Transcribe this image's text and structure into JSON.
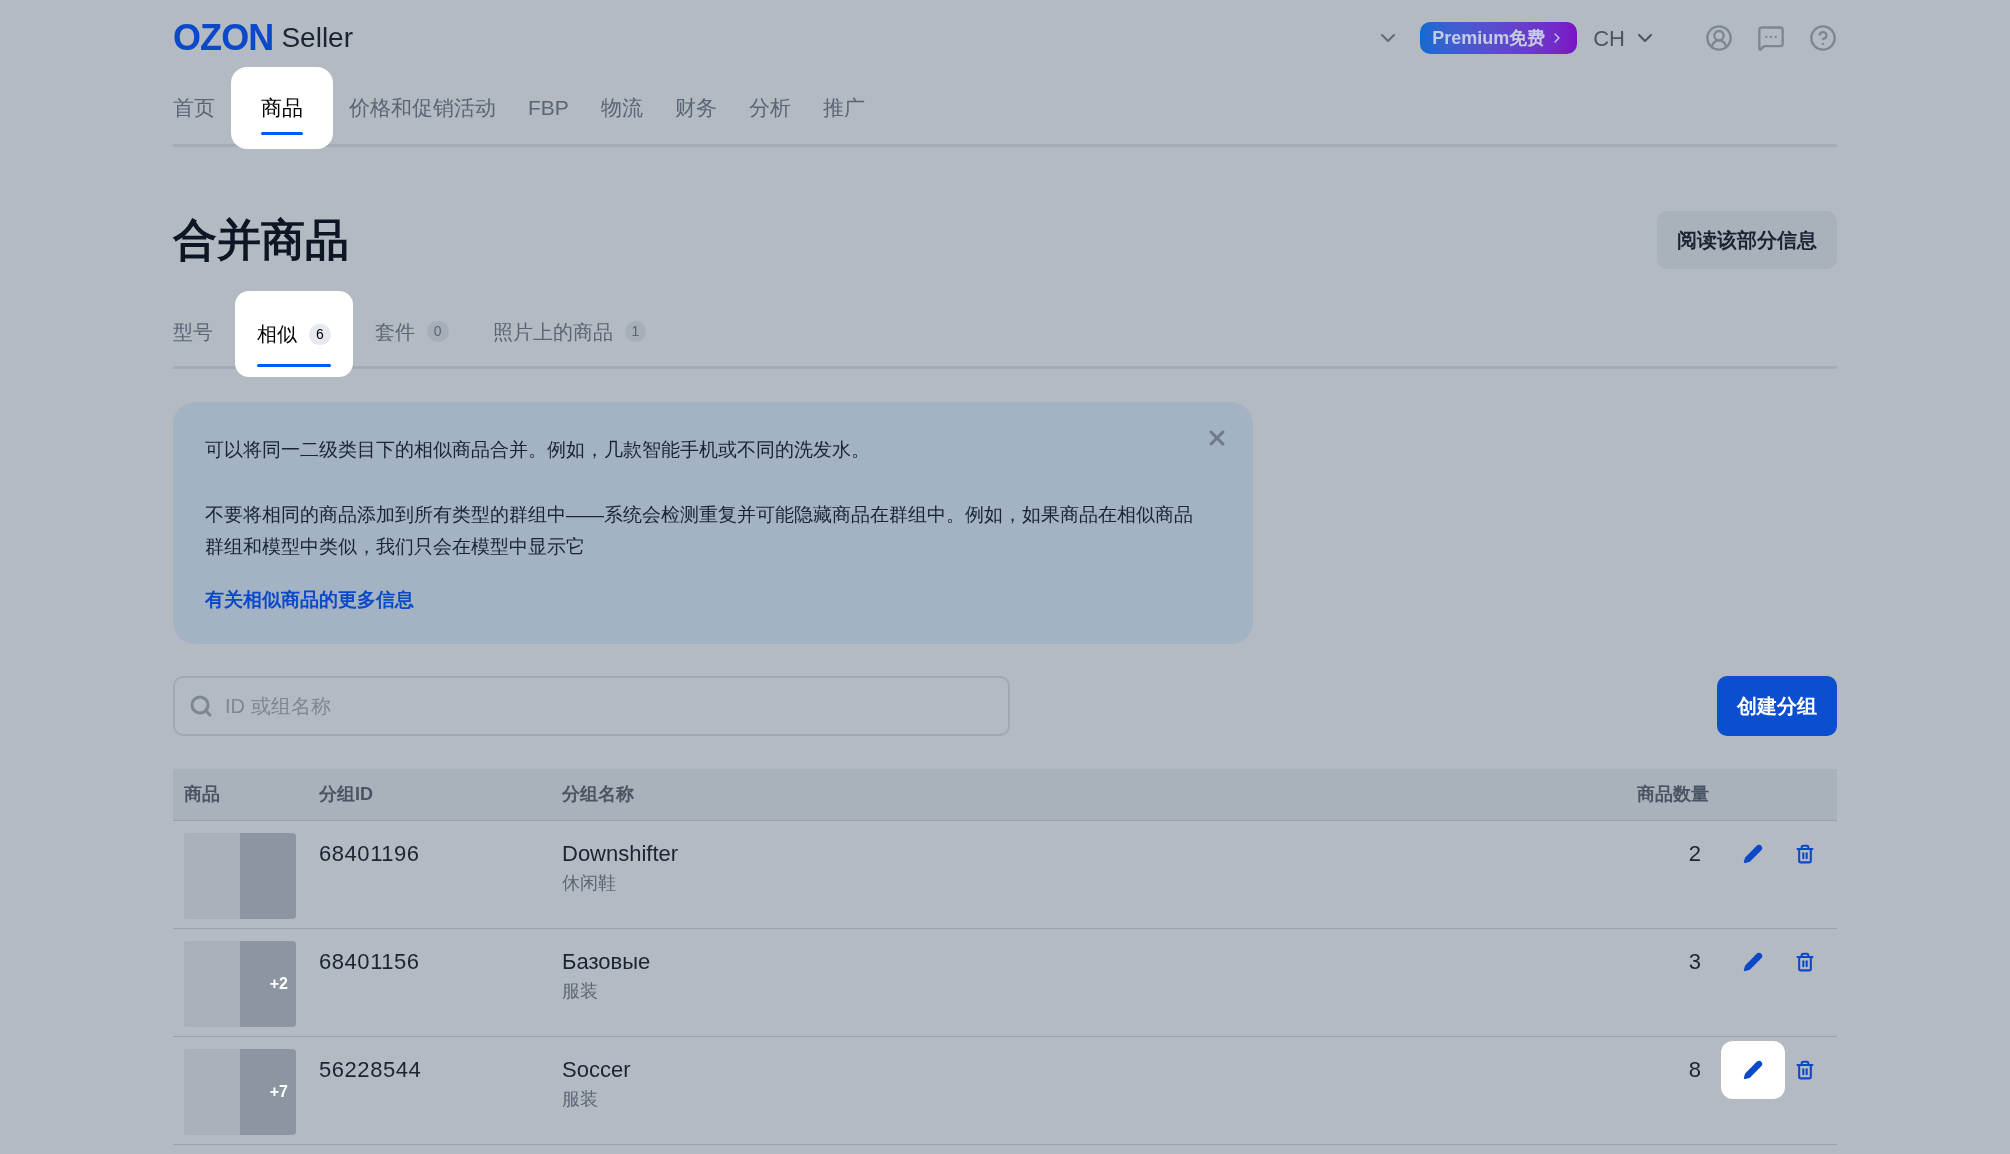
{
  "header": {
    "logo": "OZON",
    "logo_suffix": "Seller",
    "premium": "Premium免费",
    "language": "CH"
  },
  "nav": [
    {
      "label": "首页",
      "selected": false,
      "highlighted": false
    },
    {
      "label": "商品",
      "selected": true,
      "highlighted": true
    },
    {
      "label": "价格和促销活动",
      "selected": false,
      "highlighted": false
    },
    {
      "label": "FBP",
      "selected": false,
      "highlighted": false
    },
    {
      "label": "物流",
      "selected": false,
      "highlighted": false
    },
    {
      "label": "财务",
      "selected": false,
      "highlighted": false
    },
    {
      "label": "分析",
      "selected": false,
      "highlighted": false
    },
    {
      "label": "推广",
      "selected": false,
      "highlighted": false
    }
  ],
  "page_title": "合并商品",
  "read_button": "阅读该部分信息",
  "tabs": [
    {
      "label": "型号",
      "selected": false,
      "highlighted": false
    },
    {
      "label": "相似",
      "count": "6",
      "selected": true,
      "highlighted": true
    },
    {
      "label": "套件",
      "count": "0",
      "selected": false,
      "highlighted": false
    },
    {
      "label": "照片上的商品",
      "count": "1",
      "selected": false,
      "highlighted": false
    }
  ],
  "info": {
    "paragraphs": [
      "可以将同一二级类目下的相似商品合并。例如，几款智能手机或不同的洗发水。",
      "不要将相同的商品添加到所有类型的群组中——系统会检测重复并可能隐藏商品在群组中。例如，如果商品在相似商品群组和模型中类似，我们只会在模型中显示它"
    ],
    "link": "有关相似商品的更多信息"
  },
  "search": {
    "placeholder": "ID 或组名称"
  },
  "create_button": "创建分组",
  "table": {
    "columns": [
      "商品",
      "分组ID",
      "分组名称",
      "商品数量"
    ],
    "rows": [
      {
        "id": "68401196",
        "name": "Downshifter",
        "category": "休闲鞋",
        "count": "2",
        "edit_highlighted": false
      },
      {
        "id": "68401156",
        "name": "Базовые",
        "category": "服装",
        "count": "3",
        "more": "+2",
        "edit_highlighted": false
      },
      {
        "id": "56228544",
        "name": "Soccer",
        "category": "服装",
        "count": "8",
        "more": "+7",
        "edit_highlighted": true
      }
    ]
  }
}
